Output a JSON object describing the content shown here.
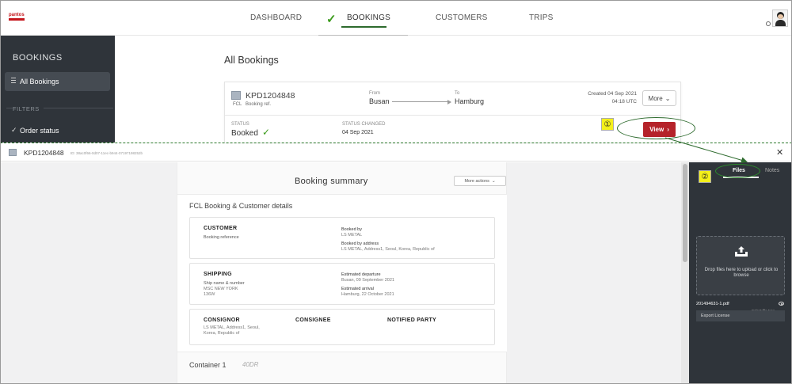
{
  "brand": {
    "logo_text": "pantos"
  },
  "nav": {
    "items": [
      "DASHBOARD",
      "BOOKINGS",
      "CUSTOMERS",
      "TRIPS"
    ],
    "active_index": 1,
    "accent_color": "#2e6b2e"
  },
  "sidebar": {
    "title": "BOOKINGS",
    "items": [
      {
        "label": "All Bookings",
        "icon": "list-icon",
        "active": true
      }
    ],
    "filters_heading": "FILTERS",
    "filters": [
      {
        "label": "Order status",
        "icon": "check-icon"
      }
    ]
  },
  "main": {
    "title": "All Bookings",
    "booking": {
      "reference": "KPD1204848",
      "mode": "FCL",
      "ref_label": "Booking ref.",
      "from_label": "From",
      "from": "Busan",
      "to_label": "To",
      "to": "Hamburg",
      "created": "Created 04 Sep 2021",
      "created_time": "04:18 UTC",
      "more_label": "More",
      "status_label": "STATUS",
      "status": "Booked",
      "status_changed_label": "STATUS CHANGED",
      "status_changed": "04 Sep 2021",
      "view_label": "View",
      "view_color": "#b5232a"
    }
  },
  "annotations": {
    "step1": "①",
    "step2": "②"
  },
  "modal": {
    "reference": "KPD1204848",
    "id_text": "ID: 38ac0f66-0d07-11ec-b944-07197198252b",
    "close_icon": "close-icon",
    "summary_title": "Booking summary",
    "more_actions": "More actions",
    "section_title": "FCL Booking & Customer details",
    "customer": {
      "heading": "CUSTOMER",
      "booking_reference_label": "Booking reference",
      "booked_by_label": "Booked by",
      "booked_by": "LS METAL",
      "booked_by_address_label": "Booked by address",
      "booked_by_address": "LS METAL, Address1, Seoul, Korea, Republic of"
    },
    "shipping": {
      "heading": "SHIPPING",
      "ship_label": "Ship name & number",
      "ship_name": "MSC NEW YORK",
      "ship_number": "136W",
      "departure_label": "Estimated departure",
      "departure": "Busan, 09 September 2021",
      "arrival_label": "Estimated arrival",
      "arrival": "Hamburg, 22 October 2021"
    },
    "parties": {
      "consignor_label": "CONSIGNOR",
      "consignor_line1": "LS METAL, Address1, Seoul,",
      "consignor_line2": "Korea, Republic of",
      "consignee_label": "CONSIGNEE",
      "notified_label": "NOTIFIED PARTY"
    },
    "container": {
      "title": "Container 1",
      "type": "40DR"
    }
  },
  "files_panel": {
    "tabs": [
      "Files",
      "Notes"
    ],
    "active_tab": 0,
    "drop_text": "Drop files here to upload or click to browse",
    "file": {
      "name": "201494631-1.pdf",
      "type_hint": "Select file type",
      "type": "Export License"
    }
  }
}
